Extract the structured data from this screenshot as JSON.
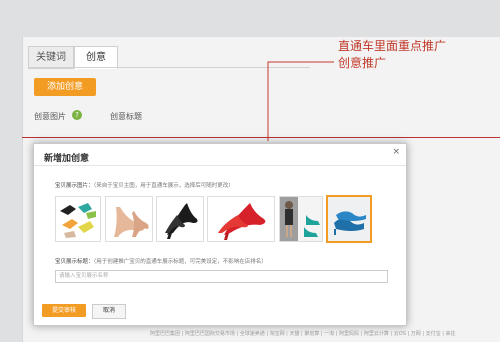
{
  "tabs": [
    {
      "label": "关键词"
    },
    {
      "label": "创意"
    }
  ],
  "toolbar": {
    "add_creative_label": "添加创意"
  },
  "columns": {
    "image": "创意图片",
    "title": "创意标题"
  },
  "annotation": {
    "line1": "直通车里面重点推广",
    "line2": "创意推广"
  },
  "dialog": {
    "title": "新增加创意",
    "close_symbol": "×",
    "image_label": "宝贝展示图片：",
    "image_hint": "（来自于宝贝主图，用于直通车展示，选择后可随时更改）",
    "title_label": "宝贝展示标题：",
    "title_hint": "（用于创建推广宝贝的直通车展示标题，可完美设定，不影响在店排名）",
    "title_placeholder": "请输入宝贝展示名称",
    "submit_label": "提交审核",
    "cancel_label": "取消"
  },
  "thumbnails": [
    {
      "name": "shoes-assorted-colors"
    },
    {
      "name": "shoe-nude-pump"
    },
    {
      "name": "shoe-black-pump"
    },
    {
      "name": "shoe-red-pump"
    },
    {
      "name": "model-with-shoes"
    },
    {
      "name": "shoes-blue-pair"
    }
  ],
  "footer": {
    "text": "阿里巴巴集团 | 阿里巴巴国际交易市场 | 全球速卖通 | 淘宝网 | 天猫 | 聚划算 | 一淘 | 阿里妈妈 | 阿里云计算 | 云OS | 万网 | 支付宝 | 来往"
  },
  "colors": {
    "accent": "#f39c24",
    "annotation": "#c0392b",
    "help": "#7cb342"
  }
}
